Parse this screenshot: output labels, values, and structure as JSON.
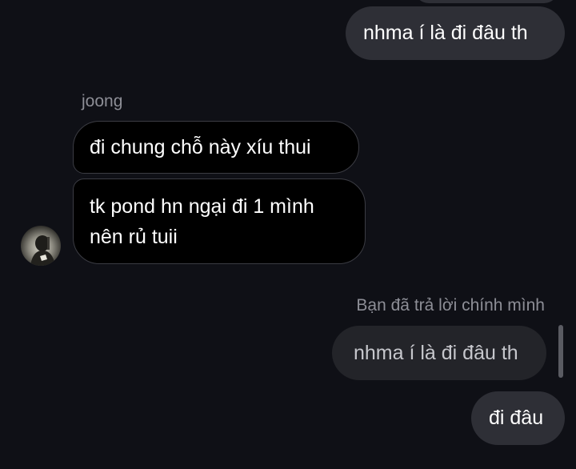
{
  "conversation": {
    "top_outgoing": {
      "text": "nhma í là đi đâu th"
    },
    "incoming": {
      "sender": "joong",
      "messages": [
        {
          "lines": [
            "đi chung chỗ này xíu thui"
          ]
        },
        {
          "lines": [
            "tk pond hn ngại đi 1 mình",
            "nên rủ tuii"
          ]
        }
      ]
    },
    "reply": {
      "meta": "Bạn đã trả lời chính mình",
      "quoted_text": "nhma í là đi đâu th",
      "text": "đi đâu"
    }
  }
}
